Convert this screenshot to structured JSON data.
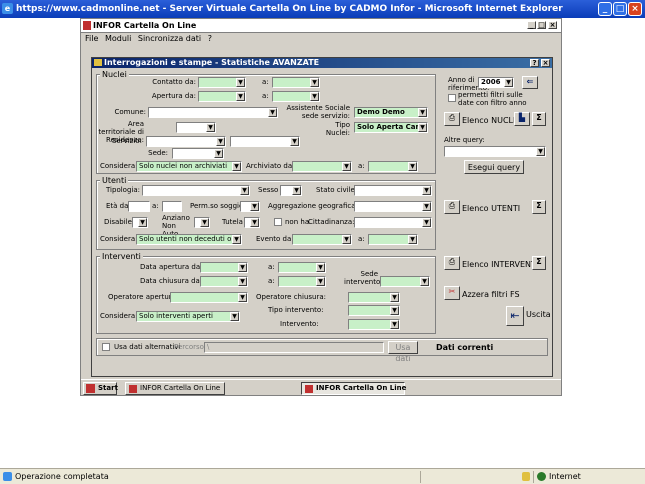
{
  "browser": {
    "title": "https://www.cadmonline.net - Server Virtuale Cartella On Line by CADMO Infor - Microsoft Internet Explorer",
    "status_text": "Operazione completata",
    "zone": "Internet"
  },
  "app": {
    "title": "INFOR Cartella On Line",
    "menu": [
      "File",
      "Moduli",
      "Sincronizza dati",
      "?"
    ]
  },
  "dialog": {
    "title": "Interrogazioni e stampe - Statistiche AVANZATE",
    "nuclei": {
      "legend": "Nuclei",
      "contatto_da": "Contatto da:",
      "apertura_da": "Apertura da:",
      "a": "a:",
      "comune": "Comune:",
      "assistente": "Assistente Sociale sede servizio:",
      "assistente_value": "Demo Demo",
      "area": "Area territoriale di Residenza:",
      "tipo_nuclei": "Tipo Nuclei:",
      "tipo_value": "Solo Aperta Cartel",
      "servizio": "Servizio:",
      "sede": "Sede:",
      "considera": "Considera:",
      "considera_value": "Solo nuclei non archiviati",
      "archiviato_da": "Archiviato da:"
    },
    "utenti": {
      "legend": "Utenti",
      "tipologia": "Tipologia:",
      "sesso": "Sesso",
      "stato_civile": "Stato civile:",
      "eta_da": "Età da:",
      "a": "a:",
      "perm_soggiorno": "Perm.so soggiorno:",
      "aggregazione": "Aggregazione geografica:",
      "disabile": "Disabile",
      "anziano": "Anziano Non Auto",
      "tutela": "Tutela",
      "non_ha": "non ha",
      "cittadinanza": "Cittadinanza:",
      "considera": "Considera:",
      "considera_value": "Solo utenti non  deceduti o tra",
      "evento_da": "Evento da:"
    },
    "interventi": {
      "legend": "Interventi",
      "data_apertura": "Data  apertura da:",
      "data_chiusura": "Data  chiusura da:",
      "a": "a:",
      "sede_intervento": "Sede intervento:",
      "operatore_apertura": "Operatore apertura:",
      "operatore_chiusura": "Operatore chiusura:",
      "tipo_intervento": "Tipo intervento:",
      "intervento": "Intervento:",
      "considera": "Considera:",
      "considera_value": "Solo interventi aperti"
    },
    "right": {
      "anno_label": "Anno di riferimento:",
      "anno_value": "2006",
      "permetti": "permetti filtri sulle date con filtro anno",
      "elenco_nuclei": "Elenco NUCLEI",
      "altre_query": "Altre query:",
      "esegui": "Esegui query",
      "elenco_utenti": "Elenco UTENTI",
      "elenco_interventi": "Elenco INTERVENTI",
      "azzera": "Azzera filtri",
      "fs": "FS",
      "uscita": "Uscita",
      "sigma": "Σ"
    },
    "bottom": {
      "usa_dati_alt": "Usa dati alternativi",
      "percorso": "Percorso:",
      "percorso_value": "\\",
      "usa_dati": "Usa dati",
      "dati_correnti": "Dati correnti"
    }
  },
  "taskbar": {
    "start": "Start",
    "task1": "INFOR Cartella On Line",
    "task2": "INFOR Cartella On Line"
  },
  "colors": {
    "ie_title": "#0a3cb8",
    "field_green": "#c8f0c8",
    "dialog_gray": "#d4d0c8",
    "inner_title": "#0a246a"
  }
}
